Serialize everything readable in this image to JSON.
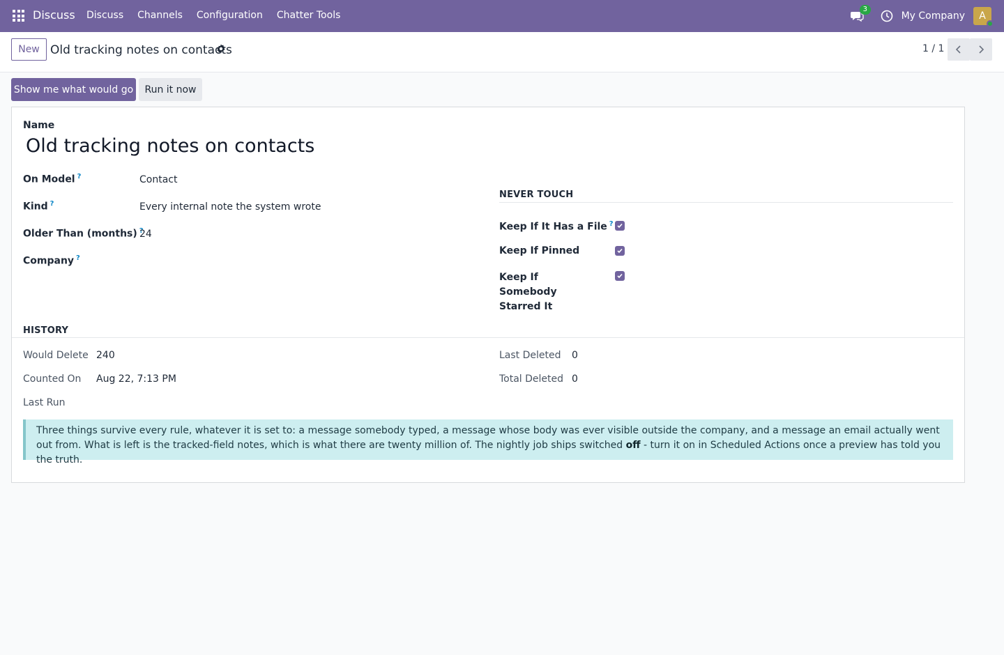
{
  "navbar": {
    "brand": "Discuss",
    "menu": [
      "Discuss",
      "Channels",
      "Configuration",
      "Chatter Tools"
    ],
    "chat_badge": "3",
    "company": "My Company",
    "avatar_letter": "A",
    "color": "#71639e"
  },
  "control": {
    "new_label": "New",
    "breadcrumb": "Old tracking notes on contacts",
    "pager": "1 / 1"
  },
  "actions": {
    "primary": "Show me what would go",
    "secondary": "Run it now"
  },
  "form": {
    "name_label": "Name",
    "name_value": "Old tracking notes on contacts",
    "fields": [
      {
        "label": "On Model",
        "value": "Contact"
      },
      {
        "label": "Kind",
        "value": "Every internal note the system wrote"
      },
      {
        "label": "Older Than (months)",
        "value": "24"
      },
      {
        "label": "Company",
        "value": ""
      }
    ],
    "never_touch": {
      "title": "NEVER TOUCH",
      "items": [
        {
          "label": "Keep If It Has a File",
          "checked": true
        },
        {
          "label": "Keep If Pinned",
          "checked": true
        },
        {
          "label": "Keep If Somebody Starred It",
          "checked": true
        }
      ]
    },
    "history": {
      "title": "HISTORY",
      "left": [
        {
          "label": "Would Delete",
          "value": "240"
        },
        {
          "label": "Counted On",
          "value": "Aug 22, 7:13 PM"
        },
        {
          "label": "Last Run",
          "value": ""
        }
      ],
      "right": [
        {
          "label": "Last Deleted",
          "value": "0"
        },
        {
          "label": "Total Deleted",
          "value": "0"
        }
      ]
    },
    "alert": {
      "text_before": "Three things survive every rule, whatever it is set to: a message somebody typed, a message whose body was ever visible outside the company, and a message an email actually went out from. What is left is the tracked-field notes, which is what there are twenty million of. The nightly job ships switched ",
      "bold": "off",
      "text_after": " - turn it on in Scheduled Actions once a preview has told you the truth."
    }
  }
}
